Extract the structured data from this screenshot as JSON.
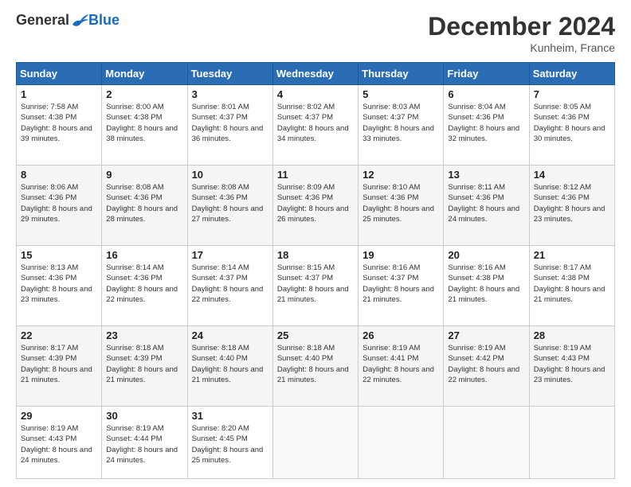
{
  "logo": {
    "general": "General",
    "blue": "Blue"
  },
  "title": "December 2024",
  "location": "Kunheim, France",
  "days_of_week": [
    "Sunday",
    "Monday",
    "Tuesday",
    "Wednesday",
    "Thursday",
    "Friday",
    "Saturday"
  ],
  "weeks": [
    [
      {
        "day": "1",
        "sunrise": "7:58 AM",
        "sunset": "4:38 PM",
        "daylight": "8 hours and 39 minutes."
      },
      {
        "day": "2",
        "sunrise": "8:00 AM",
        "sunset": "4:38 PM",
        "daylight": "8 hours and 38 minutes."
      },
      {
        "day": "3",
        "sunrise": "8:01 AM",
        "sunset": "4:37 PM",
        "daylight": "8 hours and 36 minutes."
      },
      {
        "day": "4",
        "sunrise": "8:02 AM",
        "sunset": "4:37 PM",
        "daylight": "8 hours and 34 minutes."
      },
      {
        "day": "5",
        "sunrise": "8:03 AM",
        "sunset": "4:37 PM",
        "daylight": "8 hours and 33 minutes."
      },
      {
        "day": "6",
        "sunrise": "8:04 AM",
        "sunset": "4:36 PM",
        "daylight": "8 hours and 32 minutes."
      },
      {
        "day": "7",
        "sunrise": "8:05 AM",
        "sunset": "4:36 PM",
        "daylight": "8 hours and 30 minutes."
      }
    ],
    [
      {
        "day": "8",
        "sunrise": "8:06 AM",
        "sunset": "4:36 PM",
        "daylight": "8 hours and 29 minutes."
      },
      {
        "day": "9",
        "sunrise": "8:08 AM",
        "sunset": "4:36 PM",
        "daylight": "8 hours and 28 minutes."
      },
      {
        "day": "10",
        "sunrise": "8:08 AM",
        "sunset": "4:36 PM",
        "daylight": "8 hours and 27 minutes."
      },
      {
        "day": "11",
        "sunrise": "8:09 AM",
        "sunset": "4:36 PM",
        "daylight": "8 hours and 26 minutes."
      },
      {
        "day": "12",
        "sunrise": "8:10 AM",
        "sunset": "4:36 PM",
        "daylight": "8 hours and 25 minutes."
      },
      {
        "day": "13",
        "sunrise": "8:11 AM",
        "sunset": "4:36 PM",
        "daylight": "8 hours and 24 minutes."
      },
      {
        "day": "14",
        "sunrise": "8:12 AM",
        "sunset": "4:36 PM",
        "daylight": "8 hours and 23 minutes."
      }
    ],
    [
      {
        "day": "15",
        "sunrise": "8:13 AM",
        "sunset": "4:36 PM",
        "daylight": "8 hours and 23 minutes."
      },
      {
        "day": "16",
        "sunrise": "8:14 AM",
        "sunset": "4:36 PM",
        "daylight": "8 hours and 22 minutes."
      },
      {
        "day": "17",
        "sunrise": "8:14 AM",
        "sunset": "4:37 PM",
        "daylight": "8 hours and 22 minutes."
      },
      {
        "day": "18",
        "sunrise": "8:15 AM",
        "sunset": "4:37 PM",
        "daylight": "8 hours and 21 minutes."
      },
      {
        "day": "19",
        "sunrise": "8:16 AM",
        "sunset": "4:37 PM",
        "daylight": "8 hours and 21 minutes."
      },
      {
        "day": "20",
        "sunrise": "8:16 AM",
        "sunset": "4:38 PM",
        "daylight": "8 hours and 21 minutes."
      },
      {
        "day": "21",
        "sunrise": "8:17 AM",
        "sunset": "4:38 PM",
        "daylight": "8 hours and 21 minutes."
      }
    ],
    [
      {
        "day": "22",
        "sunrise": "8:17 AM",
        "sunset": "4:39 PM",
        "daylight": "8 hours and 21 minutes."
      },
      {
        "day": "23",
        "sunrise": "8:18 AM",
        "sunset": "4:39 PM",
        "daylight": "8 hours and 21 minutes."
      },
      {
        "day": "24",
        "sunrise": "8:18 AM",
        "sunset": "4:40 PM",
        "daylight": "8 hours and 21 minutes."
      },
      {
        "day": "25",
        "sunrise": "8:18 AM",
        "sunset": "4:40 PM",
        "daylight": "8 hours and 21 minutes."
      },
      {
        "day": "26",
        "sunrise": "8:19 AM",
        "sunset": "4:41 PM",
        "daylight": "8 hours and 22 minutes."
      },
      {
        "day": "27",
        "sunrise": "8:19 AM",
        "sunset": "4:42 PM",
        "daylight": "8 hours and 22 minutes."
      },
      {
        "day": "28",
        "sunrise": "8:19 AM",
        "sunset": "4:43 PM",
        "daylight": "8 hours and 23 minutes."
      }
    ],
    [
      {
        "day": "29",
        "sunrise": "8:19 AM",
        "sunset": "4:43 PM",
        "daylight": "8 hours and 24 minutes."
      },
      {
        "day": "30",
        "sunrise": "8:19 AM",
        "sunset": "4:44 PM",
        "daylight": "8 hours and 24 minutes."
      },
      {
        "day": "31",
        "sunrise": "8:20 AM",
        "sunset": "4:45 PM",
        "daylight": "8 hours and 25 minutes."
      },
      null,
      null,
      null,
      null
    ]
  ],
  "labels": {
    "sunrise": "Sunrise:",
    "sunset": "Sunset:",
    "daylight": "Daylight:"
  }
}
